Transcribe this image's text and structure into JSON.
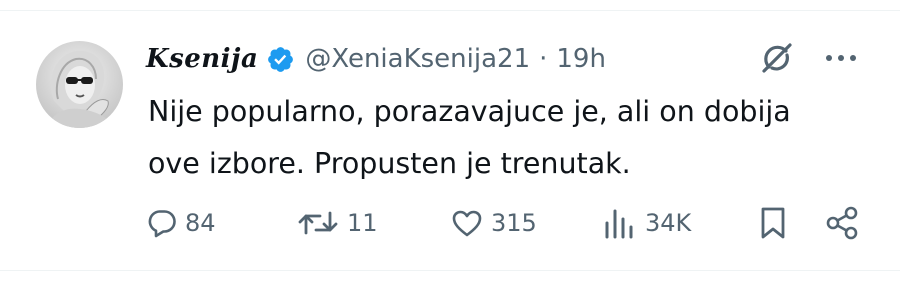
{
  "tweet": {
    "author": {
      "display_name": "Ksenija",
      "handle": "@XeniaKsenija21",
      "verified": true,
      "verified_color": "#1d9bf0"
    },
    "separator": "·",
    "time": "19h",
    "text_lines": [
      "Nije popularno, porazavajuce je, ali on dobija",
      "ove izbore. Propusten je trenutak."
    ],
    "actions": {
      "replies": "84",
      "retweets": "11",
      "likes": "315",
      "views": "34K"
    },
    "icons": {
      "reply": "speech-bubble-icon",
      "retweet": "retweet-arrows-icon",
      "like": "heart-icon",
      "views": "bar-chart-icon",
      "bookmark": "bookmark-icon",
      "share": "share-nodes-icon",
      "grok": "grok-icon",
      "more": "ellipsis-icon"
    }
  },
  "colors": {
    "text": "#0f1419",
    "secondary": "#536471",
    "divider": "#eff3f4"
  }
}
